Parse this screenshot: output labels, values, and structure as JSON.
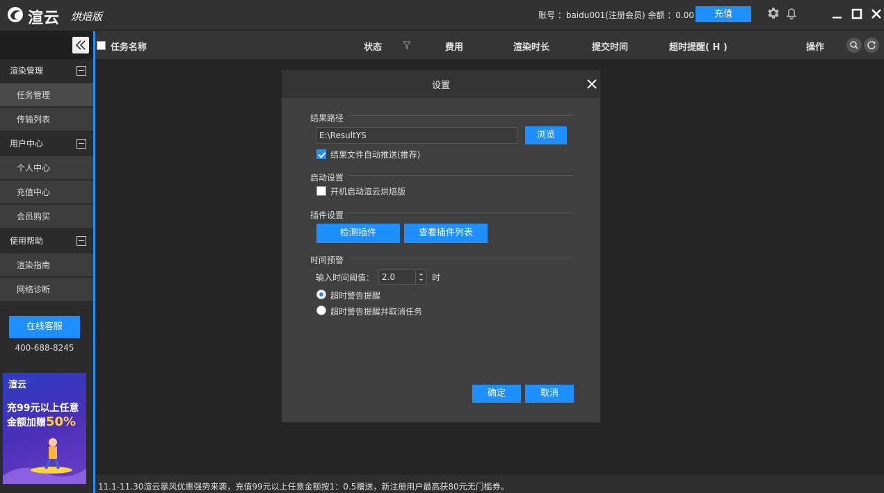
{
  "titlebar": {
    "app_name": "渲云",
    "edition": "烘焙版",
    "account_label": "账号 ：",
    "account_user": "baidu001(注册会员)",
    "balance_label": "余额 ：",
    "balance_value": "0.00",
    "recharge_label": "充值"
  },
  "sidebar": {
    "groups": [
      {
        "title": "渲染管理",
        "items": [
          "任务管理",
          "传输列表"
        ]
      },
      {
        "title": "用户中心",
        "items": [
          "个人中心",
          "充值中心",
          "会员购买"
        ]
      },
      {
        "title": "使用帮助",
        "items": [
          "渲染指南",
          "网络诊断"
        ]
      }
    ],
    "service_label": "在线客服",
    "phone": "400-688-8245",
    "ad": {
      "brand": "渲云",
      "line1": "充99元以上任意",
      "line2_prefix": "金额加赠",
      "line2_highlight": "50%"
    }
  },
  "table_header": {
    "task_name": "任务名称",
    "status": "状态",
    "cost": "费用",
    "render_time": "渲染时长",
    "submit_time": "提交时间",
    "timeout_alert": "超时提醒( H )",
    "actions": "操作"
  },
  "settings": {
    "title": "设置",
    "result_path_section": "结果路径",
    "result_path_value": "E:\\ResultYS",
    "browse_label": "浏览",
    "auto_push_label": "结果文件自动推送(推荐)",
    "auto_push_checked": true,
    "startup_section": "启动设置",
    "startup_label": "开机启动渲云烘焙版",
    "startup_checked": false,
    "plugin_section": "插件设置",
    "detect_plugin_label": "检测插件",
    "view_plugins_label": "查看插件列表",
    "time_alert_section": "时间预警",
    "threshold_label": "输入时间阈值：",
    "threshold_value": "2.0",
    "threshold_unit": "时",
    "radio_alert_label": "超时警告提醒",
    "radio_alert_cancel_label": "超时警告提醒并取消任务",
    "selected_radio": "超时警告提醒",
    "ok_label": "确定",
    "cancel_label": "取消"
  },
  "statusbar": {
    "text": "11.1-11.30渲云暴风优惠强势来袭，充值99元以上任意金额按1：0.5赠送，新注册用户最高获80元无门槛券。"
  },
  "colors": {
    "accent": "#1e8fff",
    "titlebar_bg": "#323232",
    "dialog_bg": "#3f3f3f"
  },
  "icons": [
    "logo-icon",
    "gear-icon",
    "bell-icon",
    "minimize-icon",
    "maximize-icon",
    "close-icon",
    "collapse-icon",
    "filter-icon",
    "search-icon",
    "refresh-icon",
    "dialog-close-icon"
  ]
}
